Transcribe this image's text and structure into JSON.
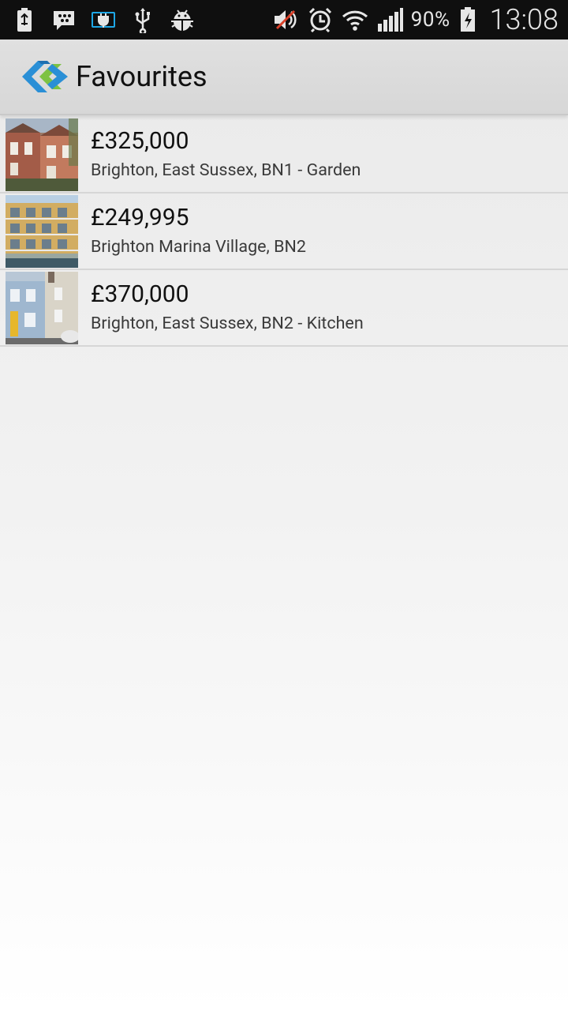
{
  "status_bar": {
    "battery_percent": "90%",
    "time": "13:08",
    "left_icons": [
      "usb-debug-battery-icon",
      "bbm-icon",
      "power-plug-icon",
      "usb-icon",
      "android-debug-icon"
    ],
    "right_icons": [
      "muted-volume-icon",
      "alarm-icon",
      "wifi-icon",
      "signal-icon",
      "battery-charging-icon"
    ]
  },
  "action_bar": {
    "title": "Favourites",
    "logo": "app-logo-icon"
  },
  "favourites": [
    {
      "price": "£325,000",
      "address": "Brighton, East Sussex, BN1 - Garden"
    },
    {
      "price": "£249,995",
      "address": "Brighton Marina Village, BN2"
    },
    {
      "price": "£370,000",
      "address": "Brighton, East Sussex, BN2 - Kitchen"
    }
  ],
  "colors": {
    "status_bar_bg": "#0f0f0f",
    "action_bar_bg": "#dcdcdc",
    "logo_blue": "#2a8fd6",
    "logo_green": "#7dc243"
  }
}
